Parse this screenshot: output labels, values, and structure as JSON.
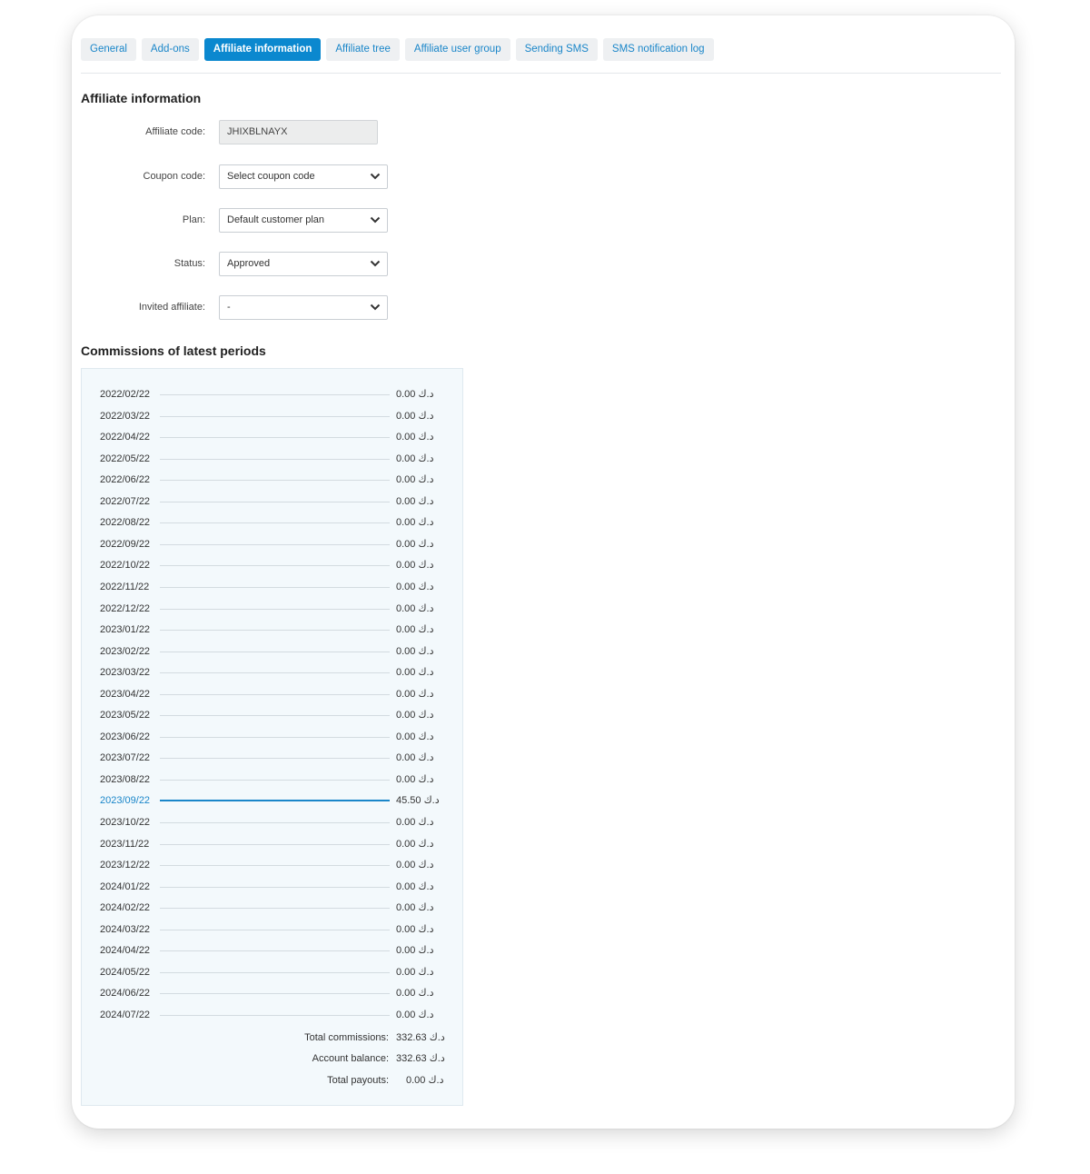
{
  "tabs": [
    {
      "label": "General",
      "active": false
    },
    {
      "label": "Add-ons",
      "active": false
    },
    {
      "label": "Affiliate information",
      "active": true
    },
    {
      "label": "Affiliate tree",
      "active": false
    },
    {
      "label": "Affiliate user group",
      "active": false
    },
    {
      "label": "Sending SMS",
      "active": false
    },
    {
      "label": "SMS notification log",
      "active": false
    }
  ],
  "affiliate_section": {
    "title": "Affiliate information",
    "affiliate_code_label": "Affiliate code:",
    "affiliate_code_value": "JHIXBLNAYX",
    "coupon_code_label": "Coupon code:",
    "coupon_code_value": "Select coupon code",
    "plan_label": "Plan:",
    "plan_value": "Default customer plan",
    "status_label": "Status:",
    "status_value": "Approved",
    "invited_affiliate_label": "Invited affiliate:",
    "invited_affiliate_value": "-"
  },
  "commissions": {
    "title": "Commissions of latest periods",
    "periods": [
      {
        "date": "2022/02/22",
        "amount": "0.00 د.ك",
        "highlight": false
      },
      {
        "date": "2022/03/22",
        "amount": "0.00 د.ك",
        "highlight": false
      },
      {
        "date": "2022/04/22",
        "amount": "0.00 د.ك",
        "highlight": false
      },
      {
        "date": "2022/05/22",
        "amount": "0.00 د.ك",
        "highlight": false
      },
      {
        "date": "2022/06/22",
        "amount": "0.00 د.ك",
        "highlight": false
      },
      {
        "date": "2022/07/22",
        "amount": "0.00 د.ك",
        "highlight": false
      },
      {
        "date": "2022/08/22",
        "amount": "0.00 د.ك",
        "highlight": false
      },
      {
        "date": "2022/09/22",
        "amount": "0.00 د.ك",
        "highlight": false
      },
      {
        "date": "2022/10/22",
        "amount": "0.00 د.ك",
        "highlight": false
      },
      {
        "date": "2022/11/22",
        "amount": "0.00 د.ك",
        "highlight": false
      },
      {
        "date": "2022/12/22",
        "amount": "0.00 د.ك",
        "highlight": false
      },
      {
        "date": "2023/01/22",
        "amount": "0.00 د.ك",
        "highlight": false
      },
      {
        "date": "2023/02/22",
        "amount": "0.00 د.ك",
        "highlight": false
      },
      {
        "date": "2023/03/22",
        "amount": "0.00 د.ك",
        "highlight": false
      },
      {
        "date": "2023/04/22",
        "amount": "0.00 د.ك",
        "highlight": false
      },
      {
        "date": "2023/05/22",
        "amount": "0.00 د.ك",
        "highlight": false
      },
      {
        "date": "2023/06/22",
        "amount": "0.00 د.ك",
        "highlight": false
      },
      {
        "date": "2023/07/22",
        "amount": "0.00 د.ك",
        "highlight": false
      },
      {
        "date": "2023/08/22",
        "amount": "0.00 د.ك",
        "highlight": false
      },
      {
        "date": "2023/09/22",
        "amount": "45.50 د.ك",
        "highlight": true
      },
      {
        "date": "2023/10/22",
        "amount": "0.00 د.ك",
        "highlight": false
      },
      {
        "date": "2023/11/22",
        "amount": "0.00 د.ك",
        "highlight": false
      },
      {
        "date": "2023/12/22",
        "amount": "0.00 د.ك",
        "highlight": false
      },
      {
        "date": "2024/01/22",
        "amount": "0.00 د.ك",
        "highlight": false
      },
      {
        "date": "2024/02/22",
        "amount": "0.00 د.ك",
        "highlight": false
      },
      {
        "date": "2024/03/22",
        "amount": "0.00 د.ك",
        "highlight": false
      },
      {
        "date": "2024/04/22",
        "amount": "0.00 د.ك",
        "highlight": false
      },
      {
        "date": "2024/05/22",
        "amount": "0.00 د.ك",
        "highlight": false
      },
      {
        "date": "2024/06/22",
        "amount": "0.00 د.ك",
        "highlight": false
      },
      {
        "date": "2024/07/22",
        "amount": "0.00 د.ك",
        "highlight": false
      }
    ],
    "totals": [
      {
        "label": "Total commissions:",
        "value": "332.63 د.ك"
      },
      {
        "label": "Account balance:",
        "value": "332.63 د.ك"
      },
      {
        "label": "Total payouts:",
        "value": "0.00 د.ك"
      }
    ]
  },
  "colors": {
    "accent": "#0b88cf",
    "link": "#1a86c9",
    "tab_bg": "#eef0f2",
    "panel_bg": "#f3f9fc"
  },
  "icons": {
    "select_arrow": "chevron-down-icon"
  }
}
